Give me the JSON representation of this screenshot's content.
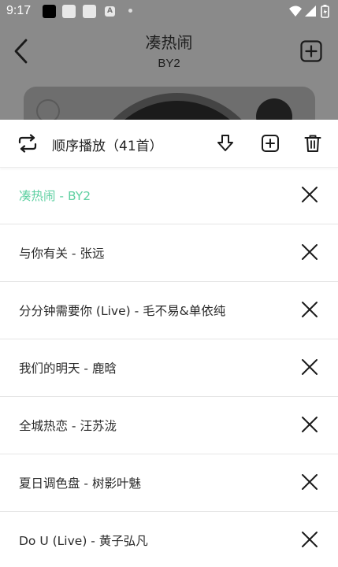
{
  "status_bar": {
    "time": "9:17",
    "notification_a": "A"
  },
  "player": {
    "title": "凑热闹",
    "artist": "BY2"
  },
  "playlist": {
    "mode_label": "顺序播放（41首）",
    "songs": [
      {
        "text": "凑热闹 - BY2",
        "active": true
      },
      {
        "text": "与你有关 - 张远",
        "active": false
      },
      {
        "text": "分分钟需要你 (Live) - 毛不易&单依纯",
        "active": false
      },
      {
        "text": "我们的明天 - 鹿晗",
        "active": false
      },
      {
        "text": "全城热恋 - 汪苏泷",
        "active": false
      },
      {
        "text": "夏日调色盘 - 树影叶魅",
        "active": false
      },
      {
        "text": "Do U (Live) - 黄子弘凡",
        "active": false
      }
    ]
  },
  "colors": {
    "active_song": "#5fd0a2",
    "overlay": "#8a8a8a"
  },
  "icons": {
    "back": "chevron-left-icon",
    "add": "plus-square-icon",
    "mode": "repeat-icon",
    "download": "download-icon",
    "trash": "trash-icon",
    "remove": "close-icon"
  }
}
